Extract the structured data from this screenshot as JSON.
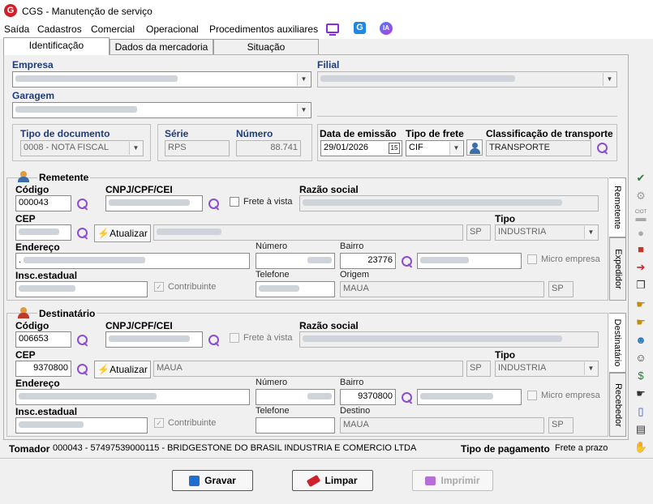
{
  "window": {
    "title": "CGS - Manutenção de serviço",
    "logo": "G"
  },
  "menu": [
    "Saída",
    "Cadastros",
    "Comercial",
    "Operacional",
    "Procedimentos auxiliares"
  ],
  "menu_icons": {
    "monitor": "monitor-icon",
    "g": "G",
    "ia": "IA"
  },
  "tabs": [
    "Identificação",
    "Dados da mercadoria",
    "Situação"
  ],
  "empresa": {
    "label": "Empresa"
  },
  "filial": {
    "label": "Filial"
  },
  "garagem": {
    "label": "Garagem"
  },
  "tipo_documento": {
    "label": "Tipo de documento",
    "value": "0008 - NOTA FISCAL"
  },
  "serie": {
    "label": "Série",
    "value": "RPS"
  },
  "numero": {
    "label": "Número",
    "value": "88.741"
  },
  "data_emissao": {
    "label": "Data de emissão",
    "value": "29/01/2026",
    "cal": "15"
  },
  "tipo_frete": {
    "label": "Tipo de frete",
    "value": "CIF"
  },
  "classificacao": {
    "label": "Classificação de transporte",
    "value": "TRANSPORTE"
  },
  "remetente": {
    "title": "Remetente",
    "codigo_label": "Código",
    "codigo": "000043",
    "cnpj_label": "CNPJ/CPF/CEI",
    "frete_vista": "Frete à vista",
    "razao_label": "Razão social",
    "cep_label": "CEP",
    "atualizar": "Atualizar",
    "uf": "SP",
    "tipo_label": "Tipo",
    "tipo": "INDUSTRIA",
    "endereco_label": "Endereço",
    "endereco_value": ".",
    "numero_label": "Número",
    "bairro_label": "Bairro",
    "bairro_value": "23776",
    "micro_empresa": "Micro empresa",
    "insc_label": "Insc.estadual",
    "contribuinte": "Contribuinte",
    "telefone_label": "Telefone",
    "origem_label": "Origem",
    "origem": "MAUA",
    "origem_uf": "SP"
  },
  "destinatario": {
    "title": "Destinatário",
    "codigo_label": "Código",
    "codigo": "006653",
    "cnpj_label": "CNPJ/CPF/CEI",
    "frete_vista": "Frete à vista",
    "razao_label": "Razão social",
    "cep_label": "CEP",
    "cep": "9370800",
    "atualizar": "Atualizar",
    "cidade": "MAUA",
    "uf": "SP",
    "tipo_label": "Tipo",
    "tipo": "INDUSTRIA",
    "endereco_label": "Endereço",
    "numero_label": "Número",
    "bairro_label": "Bairro",
    "bairro_value": "9370800",
    "micro_empresa": "Micro empresa",
    "insc_label": "Insc.estadual",
    "contribuinte": "Contribuinte",
    "telefone_label": "Telefone",
    "destino_label": "Destino",
    "destino": "MAUA",
    "destino_uf": "SP"
  },
  "side_tabs": [
    "Remetente",
    "Expedidor",
    "Destinatário",
    "Recebedor"
  ],
  "tomador": {
    "label": "Tomador",
    "value": "000043 - 57497539000115 - BRIDGESTONE DO BRASIL INDUSTRIA E COMERCIO LTDA"
  },
  "pagamento": {
    "label": "Tipo de pagamento",
    "value": "Frete a prazo"
  },
  "buttons": {
    "gravar": "Gravar",
    "limpar": "Limpar",
    "imprimir": "Imprimir"
  },
  "toolbar_ciot": "CIOT",
  "colors": {
    "accent": "#1f3b7a",
    "icon_purple": "#8a4fd0",
    "logo_red": "#d0202a"
  }
}
